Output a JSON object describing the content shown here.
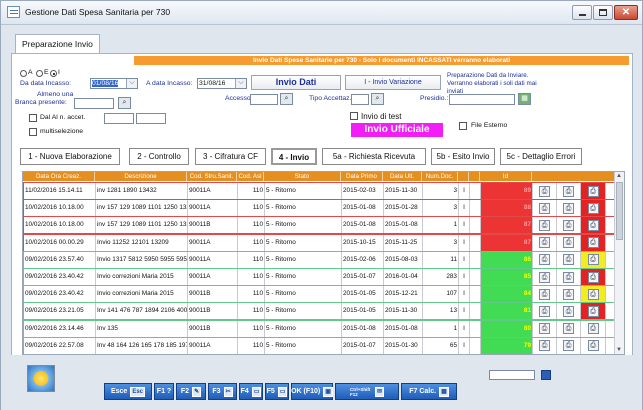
{
  "window": {
    "title": "Gestione Dati Spesa Sanitaria per 730"
  },
  "tab": {
    "label": "Preparazione Invio"
  },
  "banner": "Invio Dati Spese Sanitarie per 730 - Solo i documenti INCASSATI verranno elaborati",
  "filters": {
    "radio_a": "A",
    "radio_e": "E",
    "radio_i": "I",
    "da_data_label": "Da data Incasso:",
    "da_data_value": "01/08/16",
    "a_data_label": "A data Incasso:",
    "a_data_value": "31/08/16",
    "almeno_label": "Almeno una",
    "branca_label": "Branca presente:",
    "accesso_label": "Accesso:",
    "tipo_label": "Tipo Accettaz.:",
    "presidio_label": "Presidio.:",
    "dal_al_label": "Dal Al n. accet.",
    "multisel_label": "multiselezione",
    "invio_test_label": "Invio di test",
    "invio_ufficiale": "Invio Ufficiale",
    "file_esterno_label": "File Esterno"
  },
  "buttons": {
    "invio_dati": "Invio Dati",
    "variazione": "I - Invio Variazione",
    "preparazione_note": "Preparazione Dati da Inviare. Verranno elaborati i soli dati mai inviati"
  },
  "steps": [
    "1 - Nuova Elaborazione",
    "2 - Controllo",
    "3 - Cifratura CF",
    "4 - Invio",
    "5a - Richiesta Ricevuta",
    "5b - Esito Invio",
    "5c - Dettaglio Errori"
  ],
  "columns": [
    "Data Ora Creaz.",
    "Descrizione",
    "Cod. Stru.Sanit.",
    "Cod. Asl",
    "Stato",
    "Data Primo",
    "Data Ult.",
    "Num.Doc.",
    "",
    "Id"
  ],
  "rows": [
    {
      "data": "11/02/2016 15.14.11",
      "desc": "inv 1281 1890 13432",
      "stru": "90011A",
      "asl": "110",
      "stato": "5 - Ritorno",
      "primo": "2015-02-03",
      "ult": "2015-11-30",
      "num": "3",
      "flag": "I",
      "id": "89",
      "color": "red",
      "third": "r"
    },
    {
      "data": "10/02/2016 10.18.00",
      "desc": "inv 157 129 1089 1101 1250 13216",
      "stru": "90011A",
      "asl": "110",
      "stato": "5 - Ritorno",
      "primo": "2015-01-08",
      "ult": "2015-01-28",
      "num": "3",
      "flag": "I",
      "id": "88",
      "color": "red",
      "third": "r"
    },
    {
      "data": "10/02/2016 10.18.00",
      "desc": "inv 157 129 1089 1101 1250 13216",
      "stru": "90011B",
      "asl": "110",
      "stato": "5 - Ritorno",
      "primo": "2015-01-08",
      "ult": "2015-01-08",
      "num": "1",
      "flag": "I",
      "id": "87",
      "color": "red",
      "third": "r"
    },
    {
      "data": "10/02/2016 00.00.29",
      "desc": "Invio 11252 12101 13209",
      "stru": "90011A",
      "asl": "110",
      "stato": "5 - Ritorno",
      "primo": "2015-10-15",
      "ult": "2015-11-25",
      "num": "3",
      "flag": "I",
      "id": "87",
      "color": "red",
      "third": "r"
    },
    {
      "data": "09/02/2016 23.57.40",
      "desc": "Invio 1317 5812 5950 5955 5959 64",
      "stru": "90011A",
      "asl": "110",
      "stato": "5 - Ritorno",
      "primo": "2015-02-06",
      "ult": "2015-08-03",
      "num": "11",
      "flag": "I",
      "id": "86",
      "color": "grn",
      "third": "y"
    },
    {
      "data": "09/02/2016 23.40.42",
      "desc": "Invio correzioni Maria 2015",
      "stru": "90011A",
      "asl": "110",
      "stato": "5 - Ritorno",
      "primo": "2015-01-07",
      "ult": "2016-01-04",
      "num": "283",
      "flag": "I",
      "id": "85",
      "color": "grn",
      "third": "r"
    },
    {
      "data": "09/02/2016 23.40.42",
      "desc": "Invio correzioni Maria 2015",
      "stru": "90011B",
      "asl": "110",
      "stato": "5 - Ritorno",
      "primo": "2015-01-05",
      "ult": "2015-12-21",
      "num": "107",
      "flag": "I",
      "id": "84",
      "color": "grn",
      "third": "y"
    },
    {
      "data": "09/02/2016 23.21.05",
      "desc": "Inv 141 476 787 1894 2106 4005 49",
      "stru": "90011B",
      "asl": "110",
      "stato": "5 - Ritorno",
      "primo": "2015-01-05",
      "ult": "2015-11-30",
      "num": "13",
      "flag": "I",
      "id": "81",
      "color": "grn",
      "third": "r"
    },
    {
      "data": "09/02/2016 23.14.46",
      "desc": "Inv 135",
      "stru": "90011B",
      "asl": "110",
      "stato": "5 - Ritorno",
      "primo": "2015-01-08",
      "ult": "2015-01-08",
      "num": "1",
      "flag": "I",
      "id": "80",
      "color": "grn",
      "third": "n"
    },
    {
      "data": "09/02/2016 22.57.08",
      "desc": "Inv 48 164 126 165 178 185 197 212",
      "stru": "90011A",
      "asl": "110",
      "stato": "5 - Ritorno",
      "primo": "2015-01-07",
      "ult": "2015-01-30",
      "num": "65",
      "flag": "I",
      "id": "79",
      "color": "grn",
      "third": "n"
    }
  ],
  "toolbar": [
    {
      "label": "Esce",
      "key": "Esc"
    },
    {
      "label": "F1 ?",
      "key": ""
    },
    {
      "label": "F2",
      "key": "✎"
    },
    {
      "label": "F3",
      "key": "✂"
    },
    {
      "label": "F4",
      "key": "▭"
    },
    {
      "label": "F5",
      "key": "▭"
    },
    {
      "label": "OK (F10)",
      "key": "▣"
    },
    {
      "label": "Ctrl+Shift F12",
      "key": "✉"
    },
    {
      "label": "F7 Calc.",
      "key": "▦"
    }
  ]
}
